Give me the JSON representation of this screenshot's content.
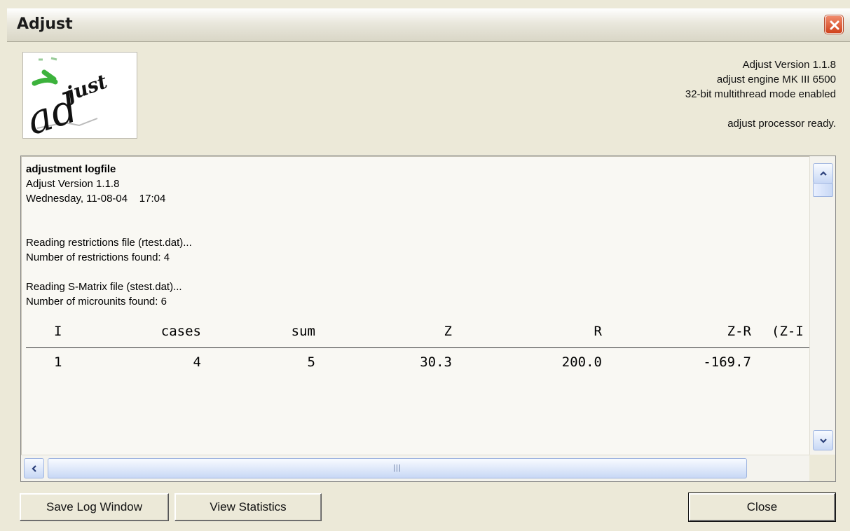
{
  "window": {
    "title": "Adjust"
  },
  "header": {
    "logo_text": "adjust",
    "info_lines": [
      "Adjust Version 1.1.8",
      "adjust engine MK III 6500",
      "32-bit multithread mode enabled"
    ],
    "status": "adjust processor ready."
  },
  "log": {
    "heading": "adjustment logfile",
    "version": "Adjust Version 1.1.8",
    "datetime": "Wednesday, 11-08-04    17:04",
    "restrictions_reading": "Reading restrictions file (rtest.dat)...",
    "restrictions_found": "Number of restrictions found: 4",
    "smatrix_reading": "Reading S-Matrix file (stest.dat)...",
    "microunits_found": "Number of microunits found: 6",
    "table": {
      "headers": [
        "I",
        "cases",
        "sum",
        "Z",
        "R",
        "Z-R",
        "(Z-I"
      ],
      "rows": [
        [
          "1",
          "4",
          "5",
          "30.3",
          "200.0",
          "-169.7"
        ]
      ]
    }
  },
  "buttons": {
    "save_log": "Save Log Window",
    "view_statistics": "View Statistics",
    "close": "Close"
  },
  "icons": {
    "window_close": "close-icon",
    "scroll_up": "arrow-up-icon",
    "scroll_down": "arrow-down-icon",
    "scroll_left": "arrow-left-icon",
    "scroll_right": "arrow-right-icon"
  },
  "colors": {
    "close_button": "#d0421c",
    "scroll_accent": "#c8d8f5"
  }
}
